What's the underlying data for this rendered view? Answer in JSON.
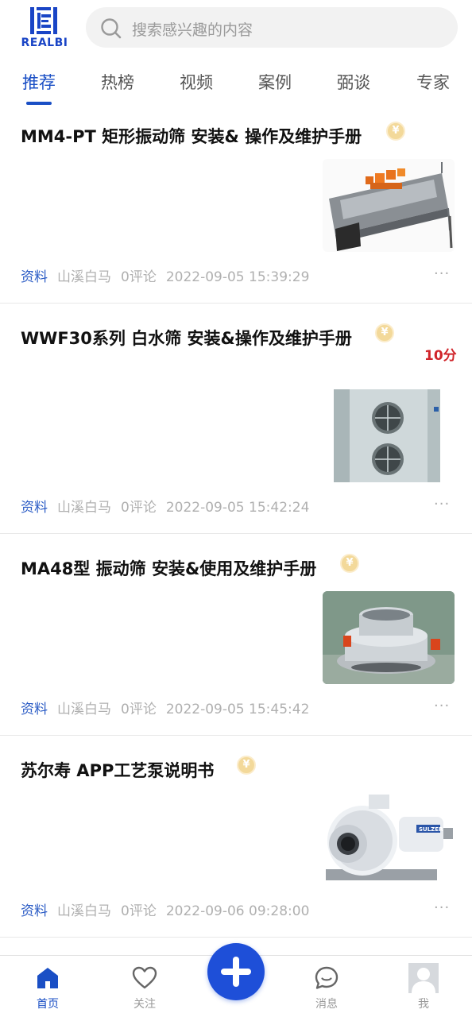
{
  "brand": {
    "logo_text": "REALBI"
  },
  "search": {
    "placeholder": "搜索感兴趣的内容"
  },
  "tabs": [
    {
      "label": "推荐",
      "active": true
    },
    {
      "label": "热榜"
    },
    {
      "label": "视频"
    },
    {
      "label": "案例"
    },
    {
      "label": "弼谈"
    },
    {
      "label": "专家"
    }
  ],
  "feed": [
    {
      "title": "MM4-PT 矩形振动筛 安装& 操作及维护手册",
      "coin": "¥",
      "category": "资料",
      "author": "山溪白马",
      "comments": "0评论",
      "time": "2022-09-05 15:39:29",
      "more": "···",
      "thumb_icon": "vibrating-screen-machine"
    },
    {
      "title": "WWF30系列 白水筛 安装&操作及维护手册",
      "coin": "¥",
      "points": "10分",
      "category": "资料",
      "author": "山溪白马",
      "comments": "0评论",
      "time": "2022-09-05 15:42:24",
      "more": "···",
      "thumb_icon": "white-water-screen-tank"
    },
    {
      "title": "MA48型 振动筛 安装&使用及维护手册",
      "coin": "¥",
      "category": "资料",
      "author": "山溪白马",
      "comments": "0评论",
      "time": "2022-09-05 15:45:42",
      "more": "···",
      "thumb_icon": "round-vibrating-sieve"
    },
    {
      "title": "苏尔寿 APP工艺泵说明书",
      "coin": "¥",
      "category": "资料",
      "author": "山溪白马",
      "comments": "0评论",
      "time": "2022-09-06 09:28:00",
      "more": "···",
      "thumb_icon": "process-pump",
      "thumb_text": "SULZER"
    }
  ],
  "bottom_nav": [
    {
      "label": "首页",
      "icon": "home-icon",
      "active": true
    },
    {
      "label": "关注",
      "icon": "heart-icon"
    },
    {
      "label": "消息",
      "icon": "chat-bubble-icon"
    },
    {
      "label": "我",
      "icon": "avatar-icon"
    }
  ],
  "colors": {
    "accent": "#1a4fc5",
    "fab": "#1e4fd8",
    "points": "#d0242a",
    "coin": "#f3d99a"
  }
}
